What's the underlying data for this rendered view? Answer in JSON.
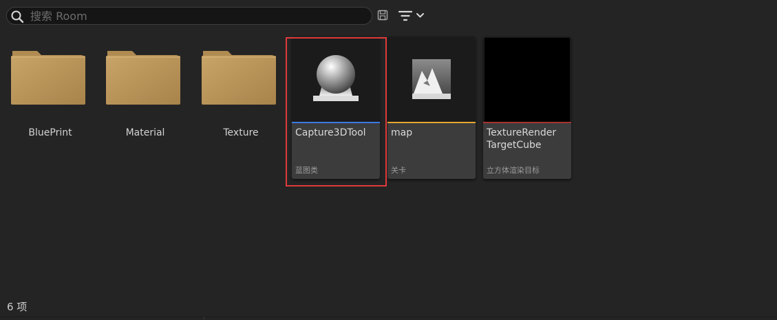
{
  "search": {
    "placeholder": "搜索 Room",
    "value": ""
  },
  "toolbar": {
    "save_search_icon": "floppy-disk-icon",
    "filter_icon": "filter-icon",
    "dropdown_icon": "chevron-down-icon"
  },
  "folders": [
    {
      "label": "BluePrint",
      "icon": "folder-icon"
    },
    {
      "label": "Material",
      "icon": "folder-icon"
    },
    {
      "label": "Texture",
      "icon": "folder-icon"
    }
  ],
  "assets": [
    {
      "name": "Capture3DTool",
      "type": "蓝图类",
      "icon": "blueprint-sphere-icon",
      "accent": "#3d7ae5",
      "selected": true
    },
    {
      "name": "map",
      "type": "关卡",
      "icon": "level-mountain-icon",
      "accent": "#e8a830",
      "selected": false
    },
    {
      "name": "TextureRender\nTargetCube",
      "type": "立方体渲染目标",
      "icon": "render-target-black",
      "accent": "#a83232",
      "selected": false
    }
  ],
  "status": {
    "item_count": "6 项"
  },
  "colors": {
    "background": "#242424",
    "folder": "#c09a5b",
    "selection": "#e03a3a"
  }
}
